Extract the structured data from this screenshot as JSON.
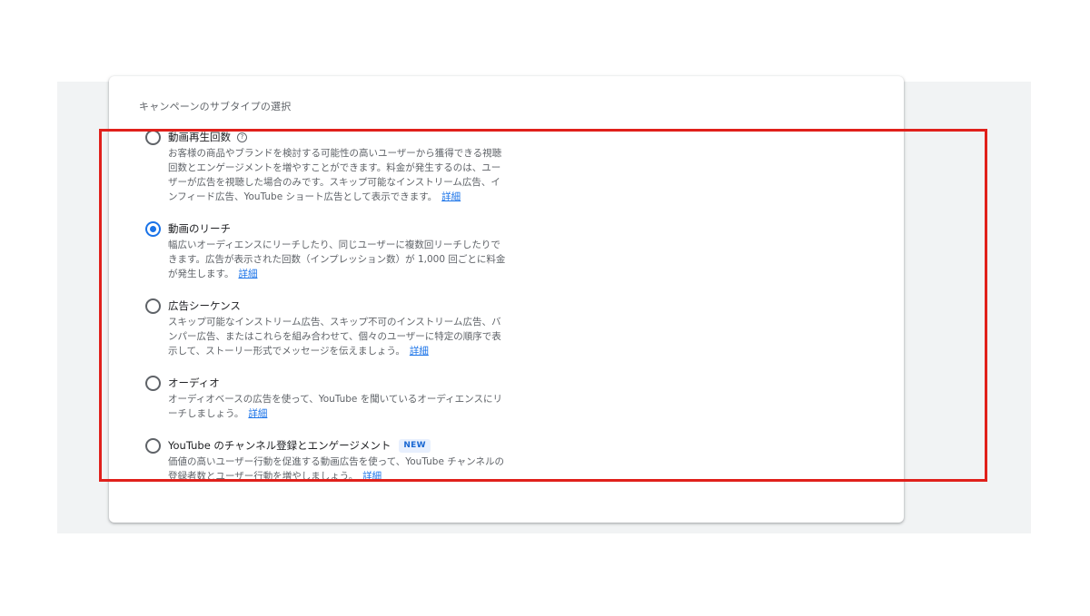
{
  "section": {
    "title": "キャンペーンのサブタイプの選択"
  },
  "options": [
    {
      "title": "動画再生回数",
      "has_help_icon": true,
      "help_icon": "?",
      "selected": false,
      "desc_lines": [
        "お客様の商品やブランドを検討する可能性の高いユーザーから獲得できる視聴",
        "回数とエンゲージメントを増やすことができます。料金が発生するのは、ユー",
        "ザーが広告を視聴した場合のみです。スキップ可能なインストリーム広告、イ",
        "ンフィード広告、YouTube ショート広告として表示できます。"
      ],
      "learn_more": "詳細"
    },
    {
      "title": "動画のリーチ",
      "selected": true,
      "desc_lines": [
        "幅広いオーディエンスにリーチしたり、同じユーザーに複数回リーチしたりで",
        "きます。広告が表示された回数（インプレッション数）が 1,000 回ごとに料金",
        "が発生します。"
      ],
      "learn_more": "詳細"
    },
    {
      "title": "広告シーケンス",
      "selected": false,
      "desc_lines": [
        "スキップ可能なインストリーム広告、スキップ不可のインストリーム広告、バ",
        "ンパー広告、またはこれらを組み合わせて、個々のユーザーに特定の順序で表",
        "示して、ストーリー形式でメッセージを伝えましょう。"
      ],
      "learn_more": "詳細"
    },
    {
      "title": "オーディオ",
      "selected": false,
      "desc_lines": [
        "オーディオベースの広告を使って、YouTube を聞いているオーディエンスにリ",
        "ーチしましょう。"
      ],
      "learn_more": "詳細"
    },
    {
      "title": "YouTube のチャンネル登録とエンゲージメント",
      "badge": "NEW",
      "selected": false,
      "desc_lines": [
        "価値の高いユーザー行動を促進する動画広告を使って、YouTube チャンネルの",
        "登録者数とユーザー行動を増やしましょう。"
      ],
      "learn_more": "詳細"
    }
  ],
  "colors": {
    "accent": "#1a73e8",
    "highlight_box": "#e0201b",
    "badge_bg": "#e8f0fe"
  }
}
